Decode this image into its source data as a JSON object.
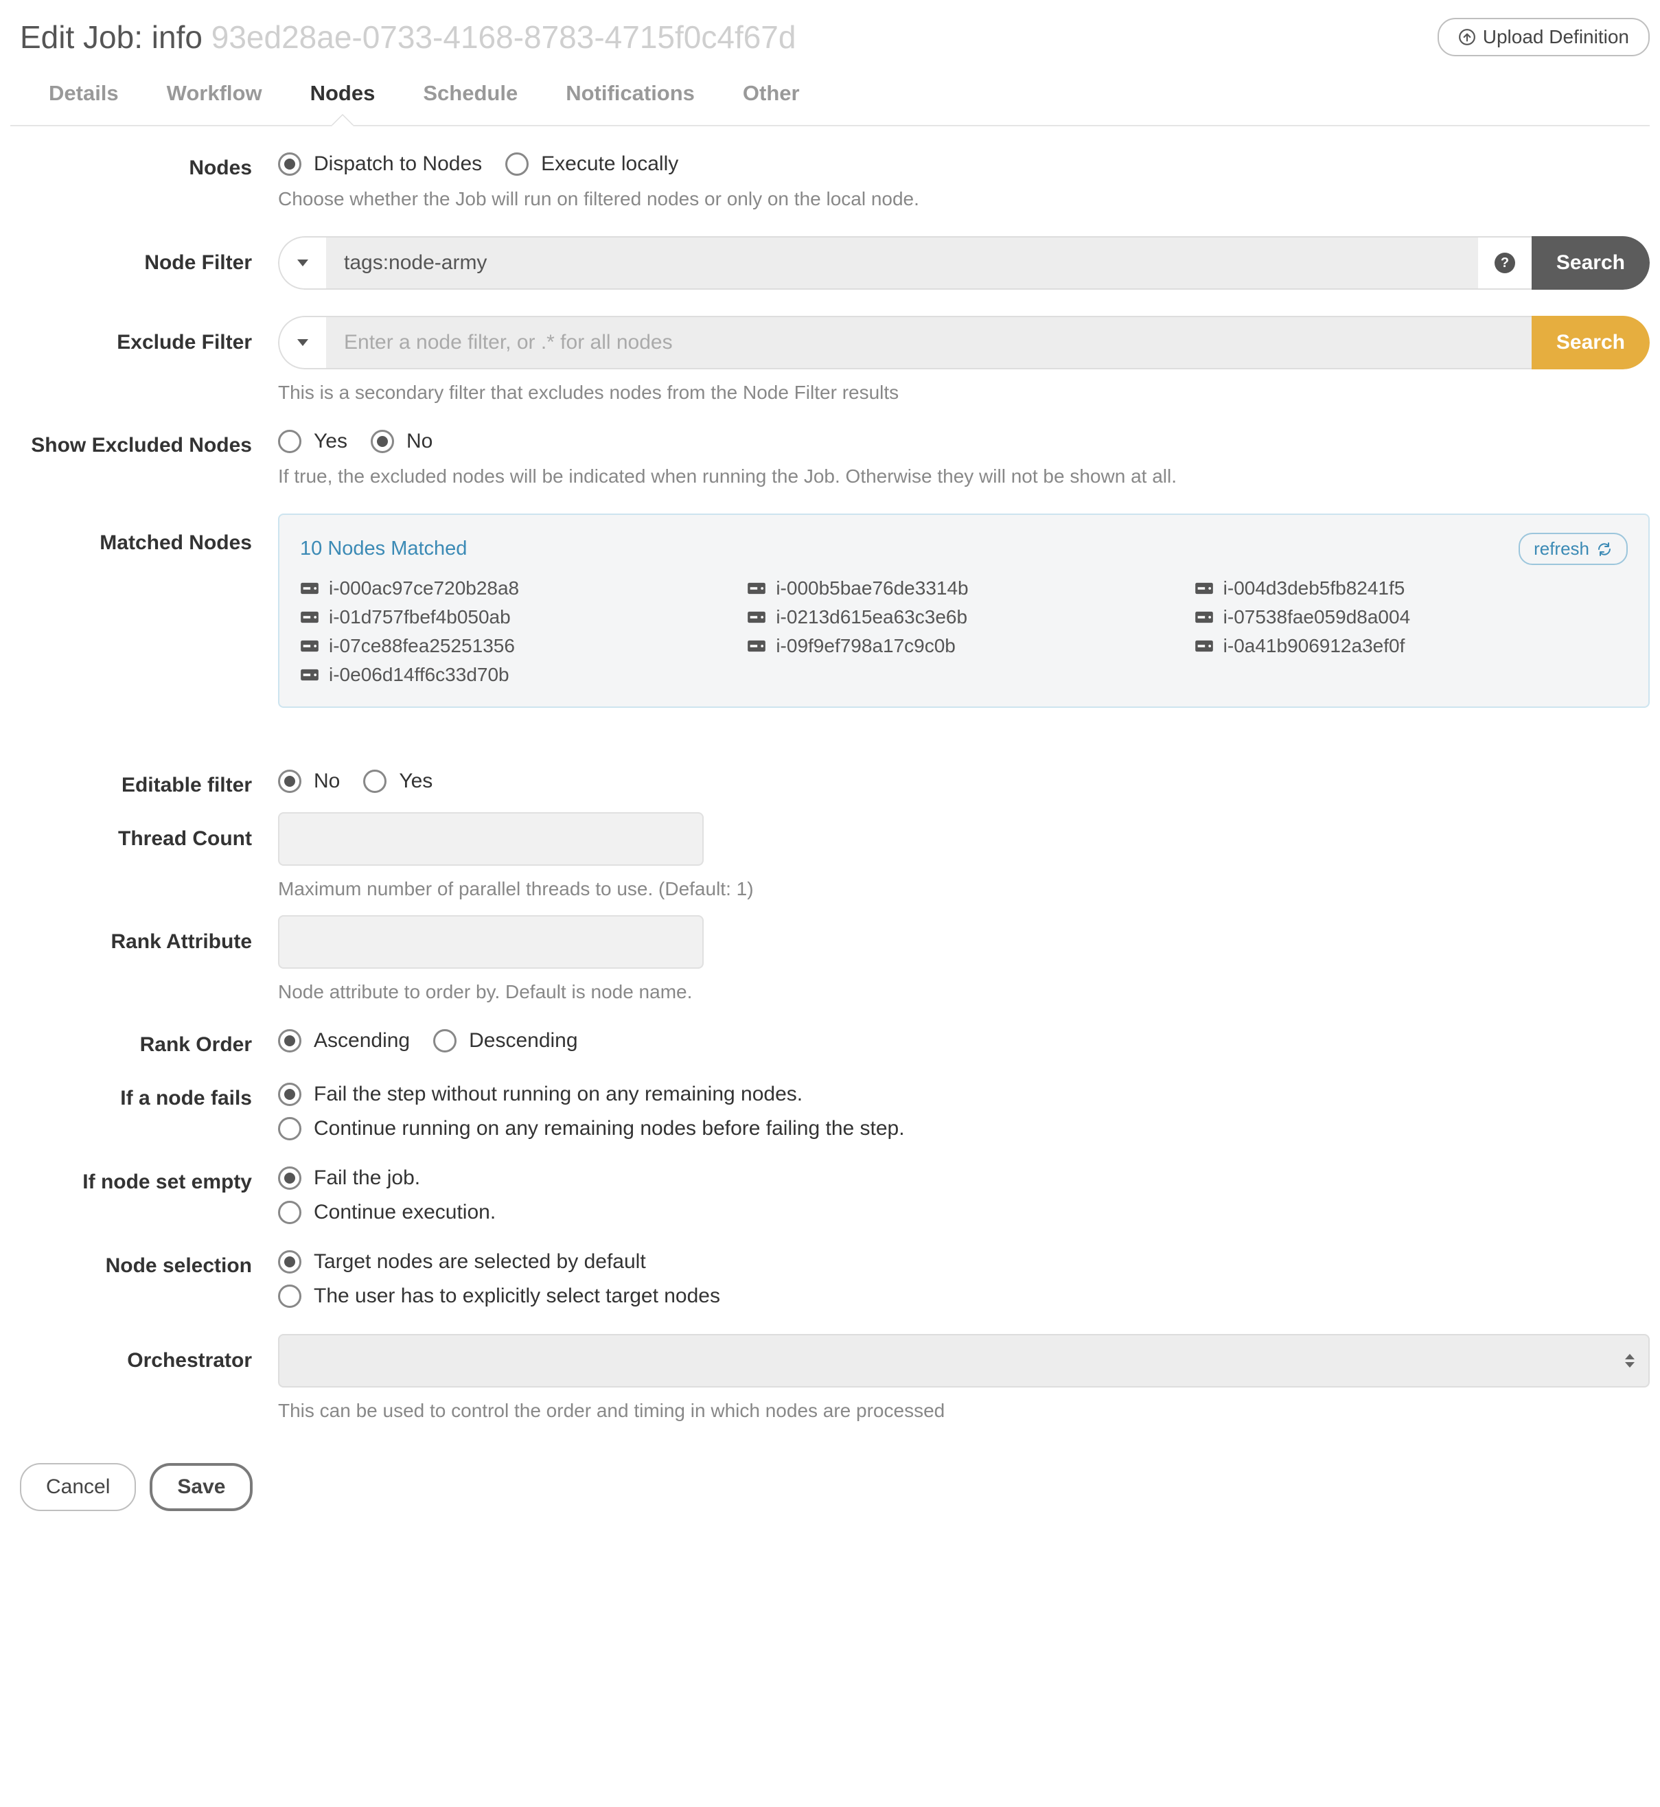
{
  "header": {
    "title_prefix": "Edit Job: ",
    "job_name": "info",
    "job_uuid": "93ed28ae-0733-4168-8783-4715f0c4f67d",
    "upload_label": "Upload Definition"
  },
  "tabs": [
    "Details",
    "Workflow",
    "Nodes",
    "Schedule",
    "Notifications",
    "Other"
  ],
  "active_tab": "Nodes",
  "nodes": {
    "section_label": "Nodes",
    "dispatch_option": "Dispatch to Nodes",
    "local_option": "Execute locally",
    "help": "Choose whether the Job will run on filtered nodes or only on the local node."
  },
  "node_filter": {
    "label": "Node Filter",
    "value": "tags:node-army",
    "search": "Search"
  },
  "exclude_filter": {
    "label": "Exclude Filter",
    "placeholder": "Enter a node filter, or .* for all nodes",
    "search": "Search",
    "help": "This is a secondary filter that excludes nodes from the Node Filter results"
  },
  "show_excluded": {
    "label": "Show Excluded Nodes",
    "yes": "Yes",
    "no": "No",
    "help": "If true, the excluded nodes will be indicated when running the Job. Otherwise they will not be shown at all."
  },
  "matched": {
    "label": "Matched Nodes",
    "title": "10 Nodes Matched",
    "refresh": "refresh",
    "col1": [
      "i-000ac97ce720b28a8",
      "i-01d757fbef4b050ab",
      "i-07ce88fea25251356",
      "i-0e06d14ff6c33d70b"
    ],
    "col2": [
      "i-000b5bae76de3314b",
      "i-0213d615ea63c3e6b",
      "i-09f9ef798a17c9c0b"
    ],
    "col3": [
      "i-004d3deb5fb8241f5",
      "i-07538fae059d8a004",
      "i-0a41b906912a3ef0f"
    ]
  },
  "editable_filter": {
    "label": "Editable filter",
    "no": "No",
    "yes": "Yes"
  },
  "thread_count": {
    "label": "Thread Count",
    "value": "",
    "help": "Maximum number of parallel threads to use. (Default: 1)"
  },
  "rank_attr": {
    "label": "Rank Attribute",
    "value": "",
    "help": "Node attribute to order by. Default is node name."
  },
  "rank_order": {
    "label": "Rank Order",
    "asc": "Ascending",
    "desc": "Descending"
  },
  "node_fails": {
    "label": "If a node fails",
    "opt1": "Fail the step without running on any remaining nodes.",
    "opt2": "Continue running on any remaining nodes before failing the step."
  },
  "empty_set": {
    "label": "If node set empty",
    "opt1": "Fail the job.",
    "opt2": "Continue execution."
  },
  "node_selection": {
    "label": "Node selection",
    "opt1": "Target nodes are selected by default",
    "opt2": "The user has to explicitly select target nodes"
  },
  "orchestrator": {
    "label": "Orchestrator",
    "value": "",
    "help": "This can be used to control the order and timing in which nodes are processed"
  },
  "footer": {
    "cancel": "Cancel",
    "save": "Save"
  }
}
